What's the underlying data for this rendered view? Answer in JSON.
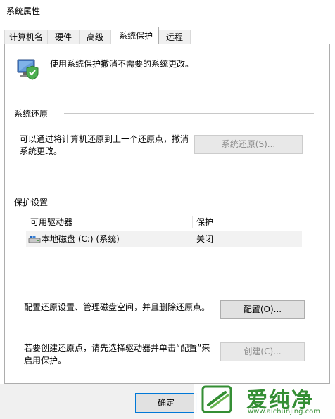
{
  "window": {
    "title": "系统属性"
  },
  "tabs": [
    {
      "label": "计算机名"
    },
    {
      "label": "硬件"
    },
    {
      "label": "高级"
    },
    {
      "label": "系统保护",
      "active": true
    },
    {
      "label": "远程"
    }
  ],
  "intro": {
    "text": "使用系统保护撤消不需要的系统更改。"
  },
  "restore": {
    "heading": "系统还原",
    "desc_line1": "可以通过将计算机还原到上一个还原点，撤消",
    "desc_line2": "系统更改。",
    "button": "系统还原(S)..."
  },
  "protection": {
    "heading": "保护设置",
    "columns": [
      "可用驱动器",
      "保护"
    ],
    "rows": [
      {
        "drive": "本地磁盘 (C:) (系统)",
        "status": "关闭"
      }
    ],
    "config_text": "配置还原设置、管理磁盘空间，并且删除还原点。",
    "config_button": "配置(O)...",
    "create_line1": "若要创建还原点，请先选择驱动器并单击“配置”来",
    "create_line2": "启用保护。",
    "create_button": "创建(C)..."
  },
  "footer": {
    "ok": "确定"
  },
  "watermark": {
    "name": "爱纯净",
    "url": "www.aichunjing.com"
  },
  "colors": {
    "accent": "#0078d7",
    "watermark_green": "#2e8b2e"
  }
}
